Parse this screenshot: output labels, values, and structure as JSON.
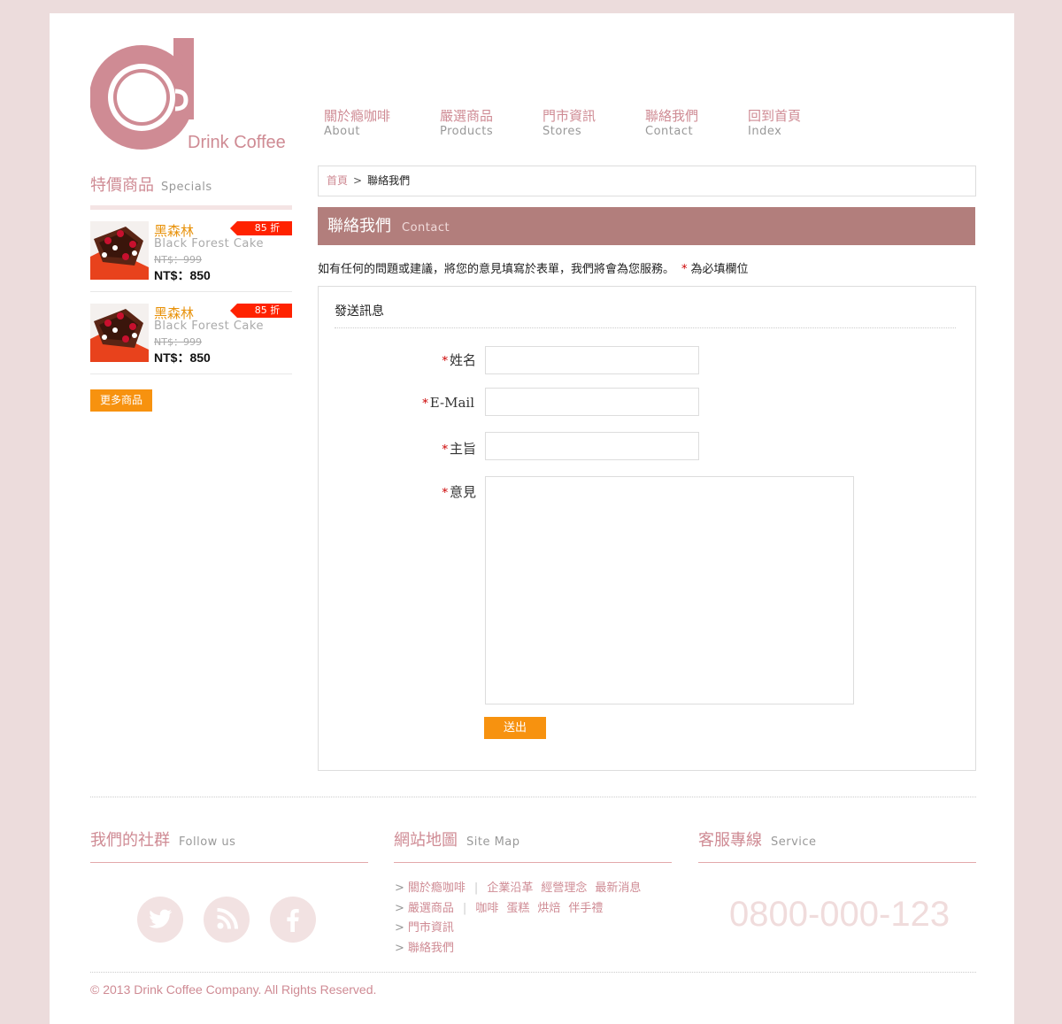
{
  "brand": {
    "name": "Drink Coffee",
    "color": "#cf8b94"
  },
  "nav": [
    {
      "zh": "關於瘾咖啡",
      "en": "About"
    },
    {
      "zh": "嚴選商品",
      "en": "Products"
    },
    {
      "zh": "門市資訊",
      "en": "Stores"
    },
    {
      "zh": "聯絡我們",
      "en": "Contact"
    },
    {
      "zh": "回到首頁",
      "en": "Index"
    }
  ],
  "specials": {
    "title_zh": "特價商品",
    "title_en": "Specials",
    "products": [
      {
        "name": "黑森林",
        "ename": "Black Forest Cake",
        "old_price": "NT$：999",
        "price": "NT$：850",
        "discount": "85 折"
      },
      {
        "name": "黑森林",
        "ename": "Black Forest Cake",
        "old_price": "NT$：999",
        "price": "NT$：850",
        "discount": "85 折"
      }
    ],
    "more_label": "更多商品"
  },
  "breadcrumb": {
    "home": "首頁",
    "sep": ">",
    "current": "聯絡我們"
  },
  "section": {
    "title_zh": "聯絡我們",
    "title_en": "Contact"
  },
  "intro": {
    "text": "如有任何的問題或建議，將您的意見填寫於表單，我們將會為您服務。",
    "star": "*",
    "required_note": "為必填欄位"
  },
  "form": {
    "title": "發送訊息",
    "required_mark": "*",
    "fields": {
      "name": "姓名",
      "email": "E-Mail",
      "subject": "主旨",
      "message": "意見"
    },
    "submit_label": "送出"
  },
  "footer": {
    "social": {
      "title_zh": "我們的社群",
      "title_en": "Follow us"
    },
    "sitemap": {
      "title_zh": "網站地圖",
      "title_en": "Site Map",
      "arrow": ">",
      "rows": [
        {
          "main": "關於瘾咖啡",
          "subs": [
            "企業沿革",
            "經營理念",
            "最新消息"
          ]
        },
        {
          "main": "嚴選商品",
          "subs": [
            "咖啡",
            "蛋糕",
            "烘焙",
            "伴手禮"
          ]
        },
        {
          "main": "門市資訊",
          "subs": []
        },
        {
          "main": "聯絡我們",
          "subs": []
        }
      ]
    },
    "service": {
      "title_zh": "客服專線",
      "title_en": "Service",
      "phone": "0800-000-123"
    },
    "copyright": "© 2013 Drink Coffee Company. All Rights Reserved."
  }
}
